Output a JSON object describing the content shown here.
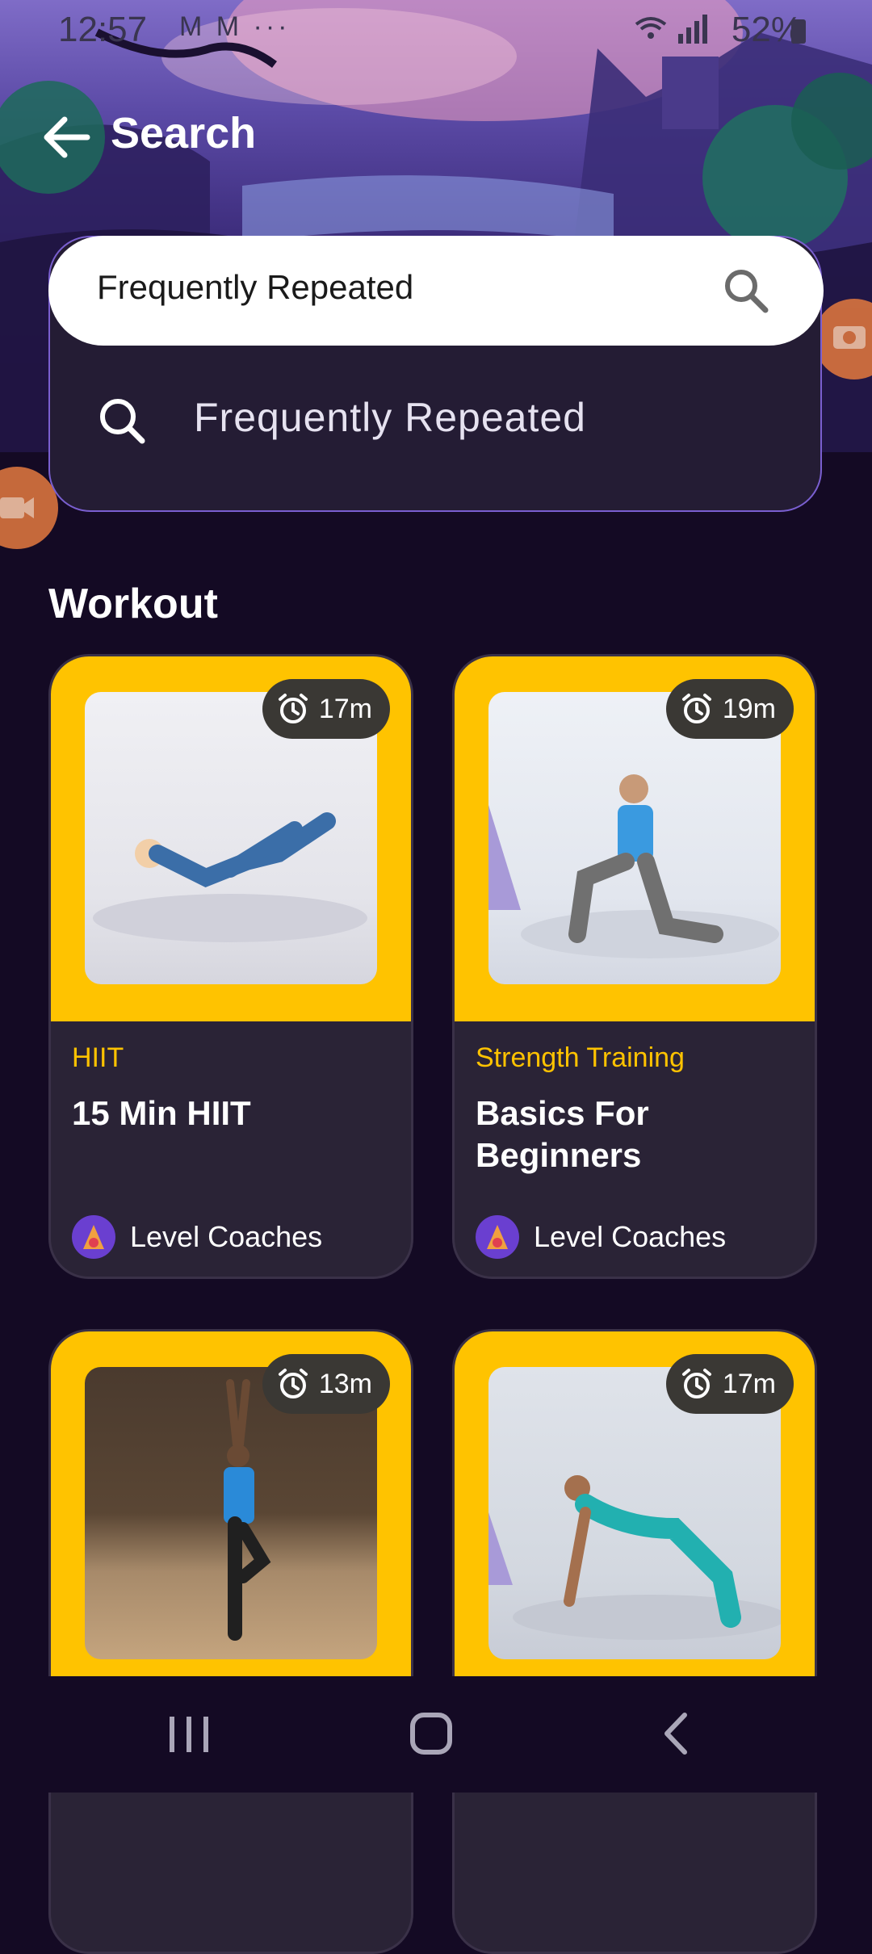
{
  "status_bar": {
    "time": "12:57",
    "notification_icons": "M  M ···",
    "battery_text": "52%"
  },
  "header": {
    "back_icon": "arrow-left-icon",
    "title": "Search"
  },
  "search": {
    "value": "Frequently Repeated",
    "suggestion": "Frequently Repeated"
  },
  "section": {
    "title": "Workout"
  },
  "cards": [
    {
      "duration": "17m",
      "category": "HIIT",
      "title": "15 Min HIIT",
      "coach": "Level Coaches"
    },
    {
      "duration": "19m",
      "category": "Strength Training",
      "title": "Basics For Beginners",
      "coach": "Level Coaches"
    },
    {
      "duration": "13m",
      "category": "",
      "title": "",
      "coach": ""
    },
    {
      "duration": "17m",
      "category": "",
      "title": "",
      "coach": ""
    }
  ],
  "colors": {
    "accent": "#ffc300",
    "background": "#140a24",
    "card": "#2a2336",
    "panel_border": "#7a5fd0"
  },
  "nav": {
    "recents_icon": "recents-icon",
    "home_icon": "home-icon",
    "back_icon": "back-chevron-icon"
  }
}
